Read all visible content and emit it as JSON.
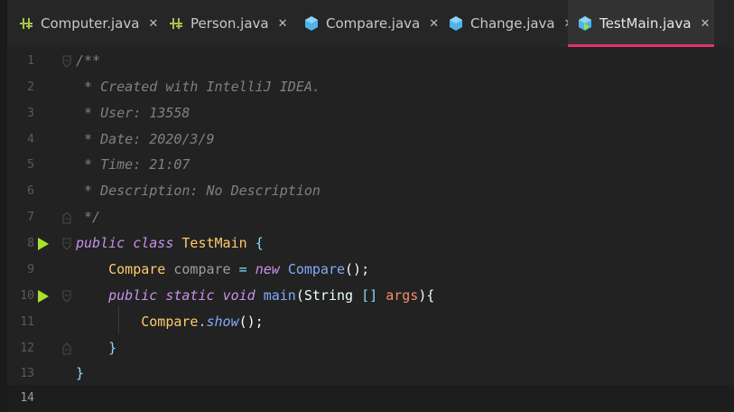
{
  "tabs": [
    {
      "label": "Computer.java",
      "icon": "class-icon",
      "close": "✕"
    },
    {
      "label": "Person.java",
      "icon": "class-icon",
      "close": "✕"
    },
    {
      "label": "Compare.java",
      "icon": "java-file-icon",
      "close": "✕"
    },
    {
      "label": "Change.java",
      "icon": "java-file-icon",
      "close": "✕"
    },
    {
      "label": "TestMain.java",
      "icon": "java-main-icon",
      "close": "✕",
      "active": true
    }
  ],
  "colors": {
    "accent": "#e0326e",
    "background": "#222222",
    "run": "#a6e22e"
  },
  "editor": {
    "line_numbers": [
      "1",
      "2",
      "3",
      "4",
      "5",
      "6",
      "7",
      "8",
      "9",
      "10",
      "11",
      "12",
      "13",
      "14"
    ],
    "lines": {
      "l1": "/**",
      "l2": " * Created with IntelliJ IDEA.",
      "l3": " * User: 13558",
      "l4": " * Date: 2020/3/9",
      "l5": " * Time: 21:07",
      "l6": " * Description: No Description",
      "l7": " */",
      "l8": {
        "kw1": "public",
        "kw2": "class",
        "name": "TestMain",
        "brace": "{"
      },
      "l9": {
        "type": "Compare",
        "var": "compare",
        "eq": "=",
        "kw": "new",
        "ctor": "Compare",
        "paren": "();"
      },
      "l10": {
        "kw1": "public",
        "kw2": "static",
        "kw3": "void",
        "name": "main",
        "open": "(",
        "ptype": "String",
        "brackets": "[]",
        "param": "args",
        "close": "){"
      },
      "l11": {
        "cls": "Compare",
        "dot": ".",
        "method": "show",
        "paren": "();"
      },
      "l12": "}",
      "l13": "}",
      "l14": ""
    }
  }
}
